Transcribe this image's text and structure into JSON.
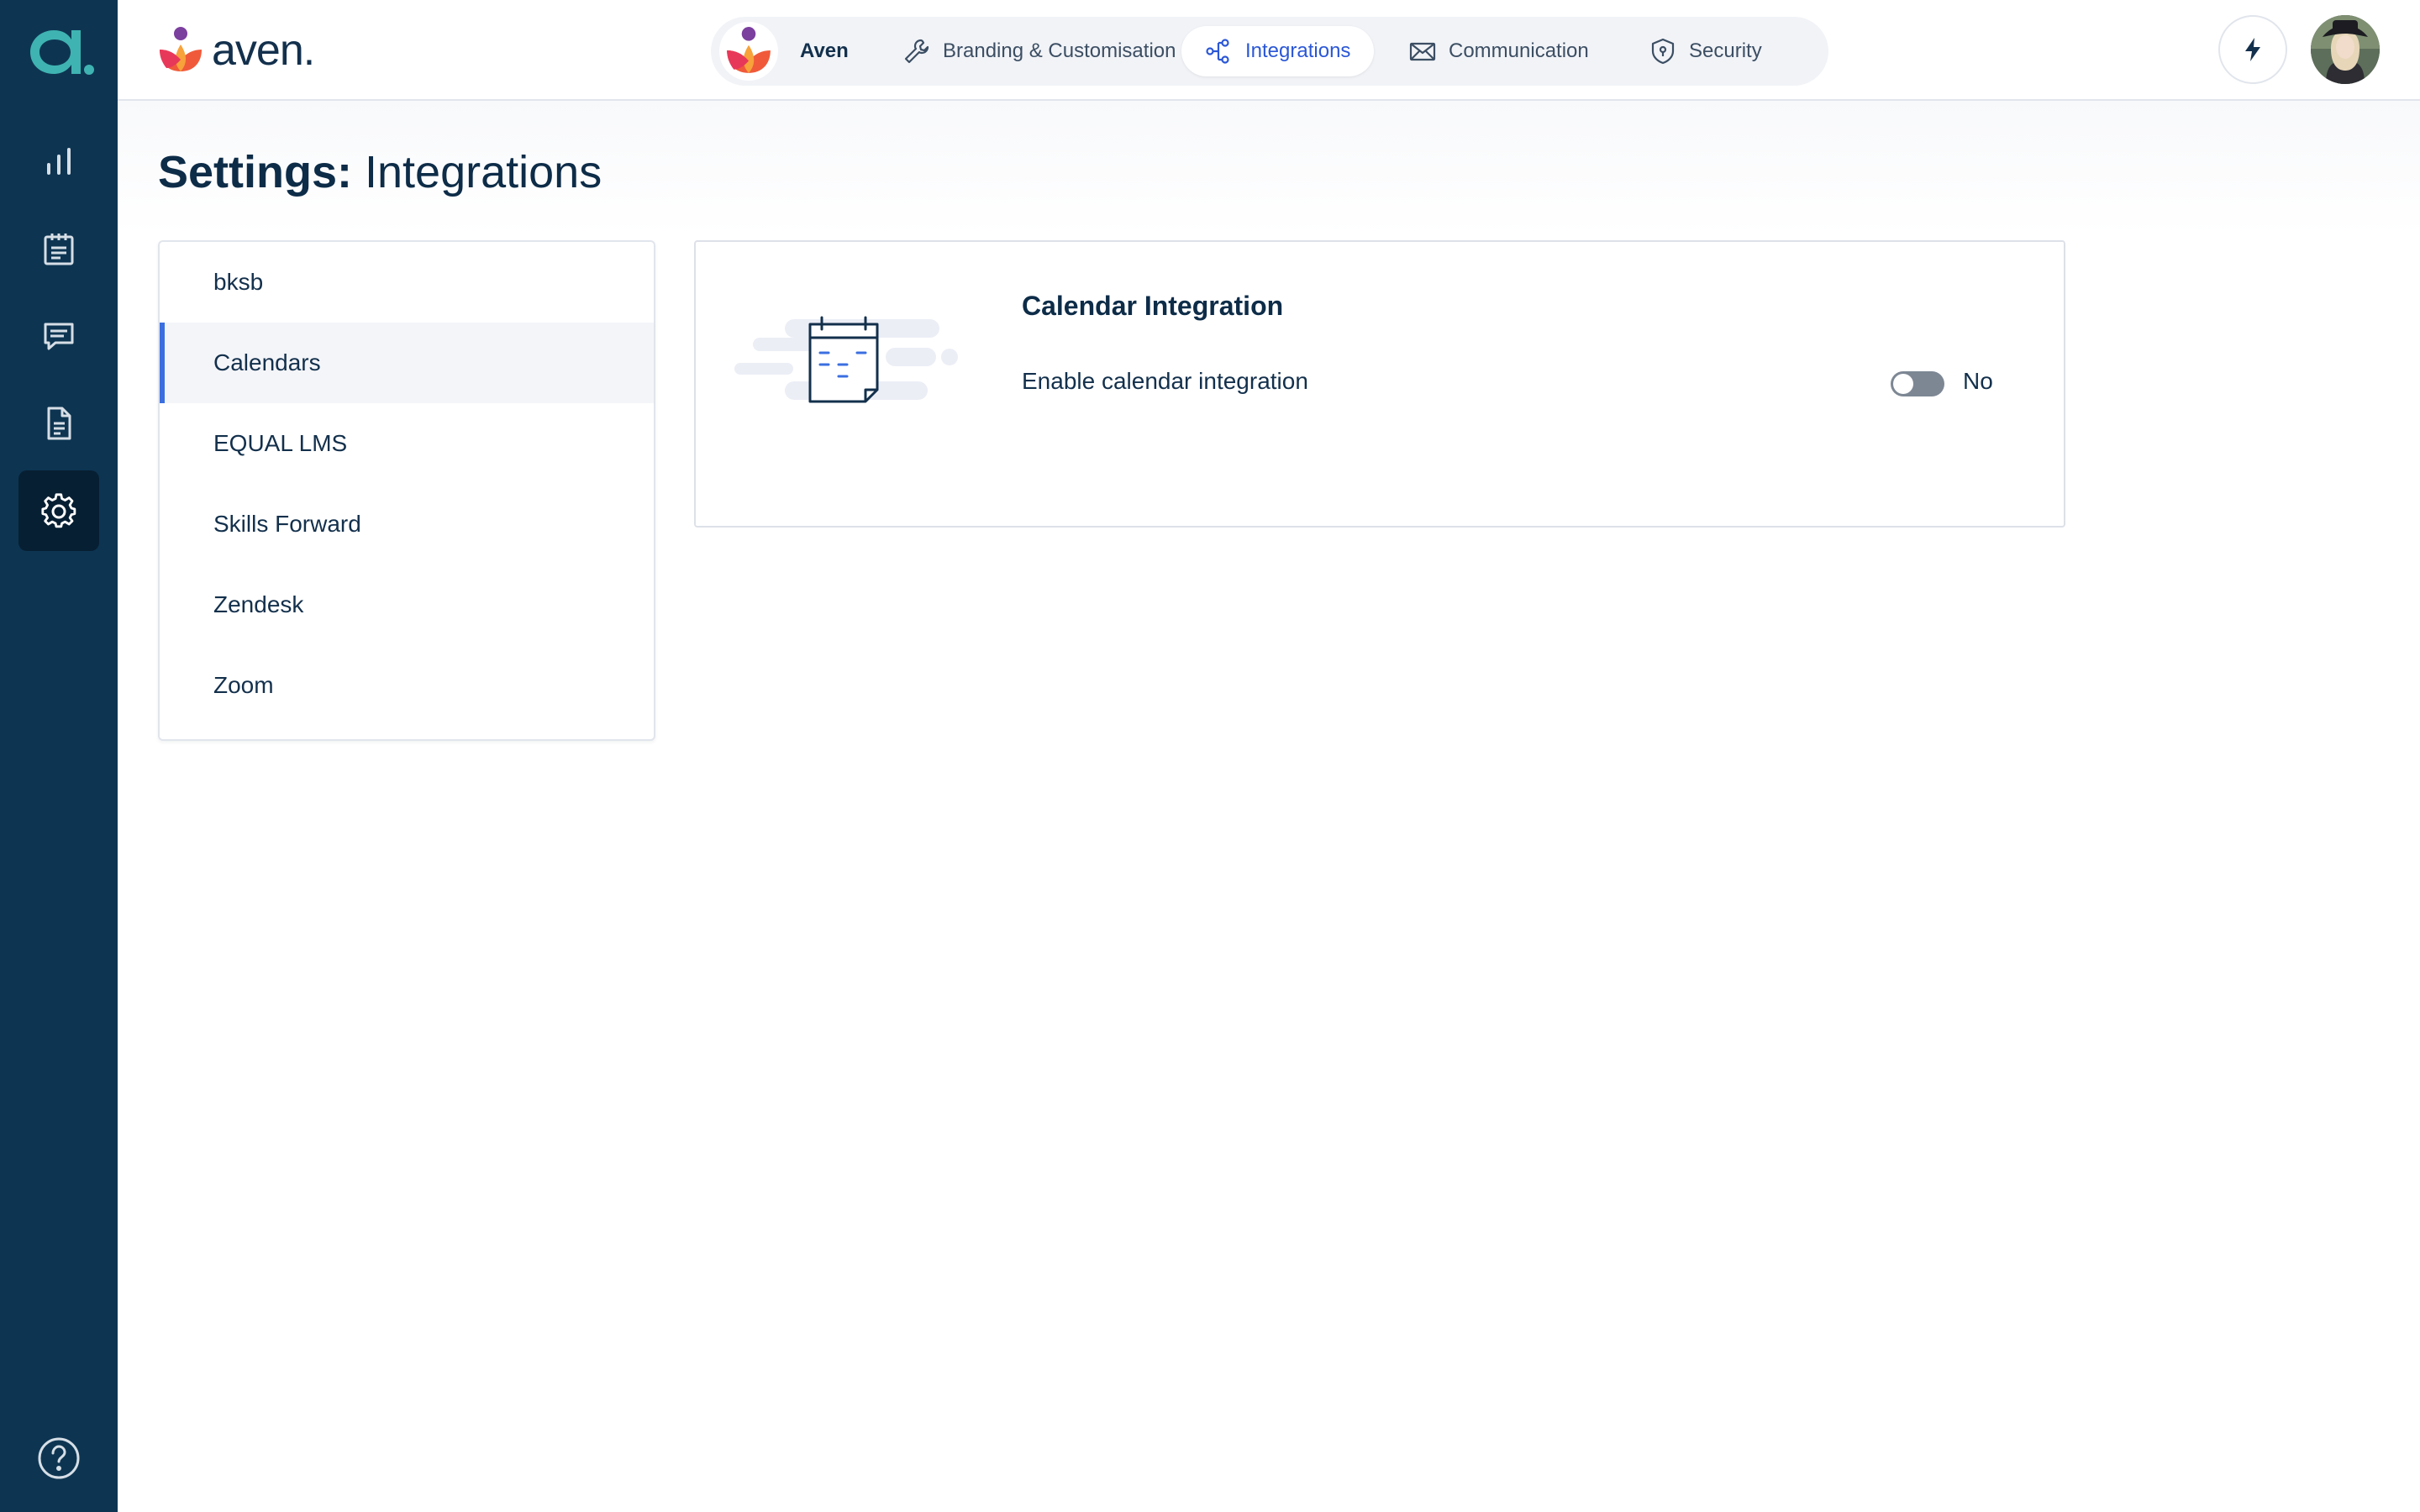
{
  "rail": {
    "items": [
      {
        "icon": "bar-chart-icon"
      },
      {
        "icon": "clipboard-icon"
      },
      {
        "icon": "chat-icon"
      },
      {
        "icon": "document-icon"
      },
      {
        "icon": "gear-icon",
        "active": true
      }
    ],
    "help_icon": "help-circle-icon"
  },
  "header": {
    "brand": "aven.",
    "org_name": "Aven",
    "tabs": [
      {
        "label": "Branding & Customisation",
        "icon": "wrench-icon"
      },
      {
        "label": "Integrations",
        "icon": "nodes-icon",
        "active": true
      },
      {
        "label": "Communication",
        "icon": "envelope-icon"
      },
      {
        "label": "Security",
        "icon": "shield-icon"
      }
    ]
  },
  "page": {
    "title_bold": "Settings:",
    "title_rest": " Integrations"
  },
  "integrations": {
    "items": [
      {
        "label": "bksb"
      },
      {
        "label": "Calendars",
        "active": true
      },
      {
        "label": "EQUAL LMS"
      },
      {
        "label": "Skills Forward"
      },
      {
        "label": "Zendesk"
      },
      {
        "label": "Zoom"
      }
    ]
  },
  "detail": {
    "title": "Calendar Integration",
    "setting_label": "Enable calendar integration",
    "toggle_value": "No",
    "toggle_on": false
  },
  "colors": {
    "sidebar": "#0d3552",
    "accent": "#2b57d6",
    "active_bar": "#3b6fe0",
    "teal_logo": "#3fb3b1"
  }
}
